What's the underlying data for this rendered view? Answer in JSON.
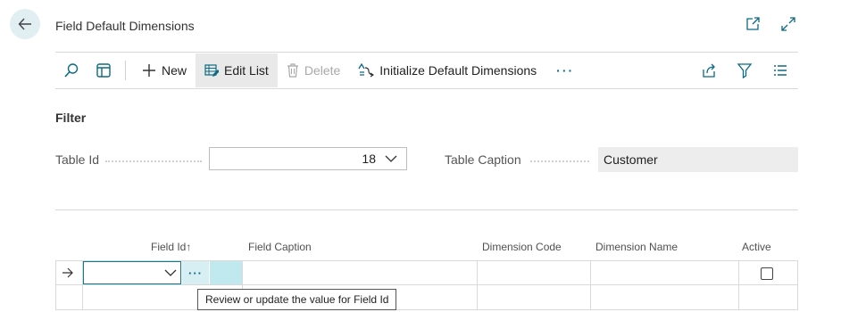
{
  "page": {
    "title": "Field Default Dimensions"
  },
  "actions": {
    "new": "New",
    "edit_list": "Edit List",
    "delete": "Delete",
    "initialize": "Initialize Default Dimensions",
    "more": "···"
  },
  "filter": {
    "title": "Filter",
    "table_id_label": "Table Id",
    "table_id_value": "18",
    "table_caption_label": "Table Caption",
    "table_caption_value": "Customer"
  },
  "grid": {
    "columns": [
      "Field Id",
      "Field Caption",
      "Dimension Code",
      "Dimension Name",
      "Active"
    ],
    "sort_indicator": "↑",
    "lookup_label": "···"
  },
  "tooltip": {
    "text": "Review or update the value for Field Id"
  },
  "colors": {
    "accent": "#0d7a93",
    "back_bg": "#e1eff3",
    "highlight": "#bfe9ef"
  }
}
